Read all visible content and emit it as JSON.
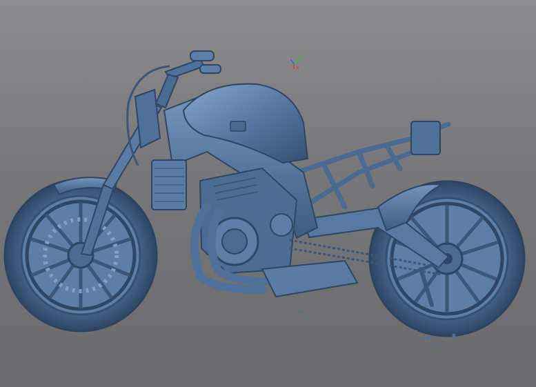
{
  "viewport": {
    "background_top": "#8d8d8f",
    "background_bottom": "#6b6b6d",
    "model_color": "#4d6f97",
    "model_shadow": "#2e4563",
    "model_highlight": "#8fb0d6"
  },
  "triad": {
    "x_label": "X",
    "y_label": "Y",
    "z_label": "Z",
    "x_color": "#d23c3c",
    "y_color": "#3cc23c",
    "z_color": "#3c5cd2"
  }
}
